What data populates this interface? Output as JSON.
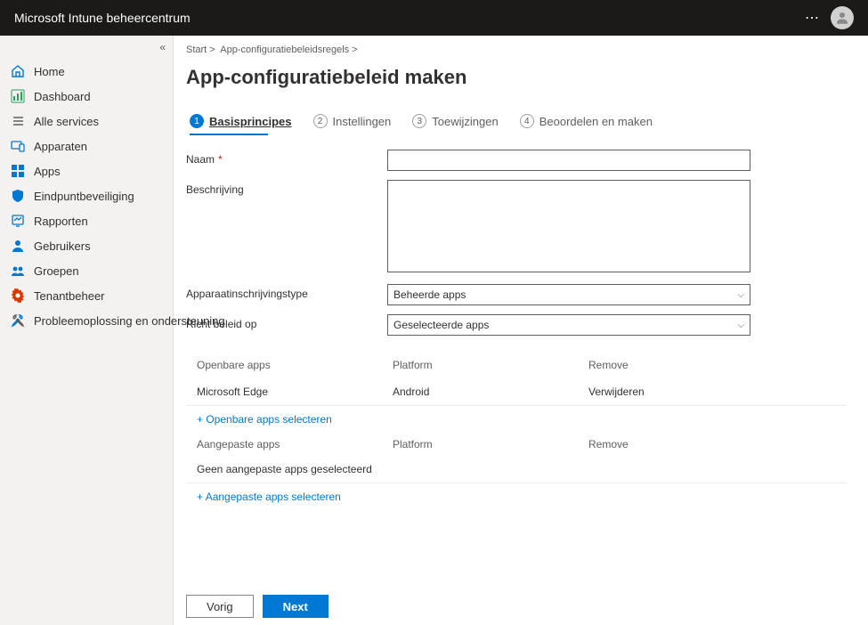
{
  "header": {
    "title": "Microsoft Intune beheercentrum"
  },
  "sidebar": {
    "items": [
      {
        "label": "Home"
      },
      {
        "label": "Dashboard"
      },
      {
        "label": "Alle services"
      },
      {
        "label": "Apparaten"
      },
      {
        "label": "Apps"
      },
      {
        "label": "Eindpuntbeveiliging"
      },
      {
        "label": "Rapporten"
      },
      {
        "label": "Gebruikers"
      },
      {
        "label": "Groepen"
      },
      {
        "label": "Tenantbeheer"
      },
      {
        "label": "Probleemoplossing en ondersteuning"
      }
    ]
  },
  "breadcrumb": {
    "part1": "Start >",
    "part2": "App-configuratiebeleidsregels >"
  },
  "page": {
    "title": "App-configuratiebeleid maken"
  },
  "wizard": {
    "steps": [
      {
        "num": "1",
        "label": "Basisprincipes"
      },
      {
        "num": "2",
        "label": "Instellingen"
      },
      {
        "num": "3",
        "label": "Toewijzingen"
      },
      {
        "num": "4",
        "label": "Beoordelen en maken"
      }
    ]
  },
  "form": {
    "name_label": "Naam",
    "name_value": "",
    "desc_label": "Beschrijving",
    "desc_value": "",
    "enroll_label": "Apparaatinschrijvingstype",
    "enroll_value": "Beheerde apps",
    "target_label": "Richt beleid op",
    "target_value": "Geselecteerde apps"
  },
  "public_apps": {
    "header1": "Openbare apps",
    "header2": "Platform",
    "header3": "Remove",
    "rows": [
      {
        "name": "Microsoft Edge",
        "platform": "Android",
        "remove": "Verwijderen"
      }
    ],
    "add": "Openbare apps selecteren"
  },
  "custom_apps": {
    "header1": "Aangepaste apps",
    "header2": "Platform",
    "header3": "Remove",
    "empty": "Geen aangepaste apps geselecteerd",
    "add": "Aangepaste apps selecteren"
  },
  "footer": {
    "prev": "Vorig",
    "next": "Next"
  }
}
